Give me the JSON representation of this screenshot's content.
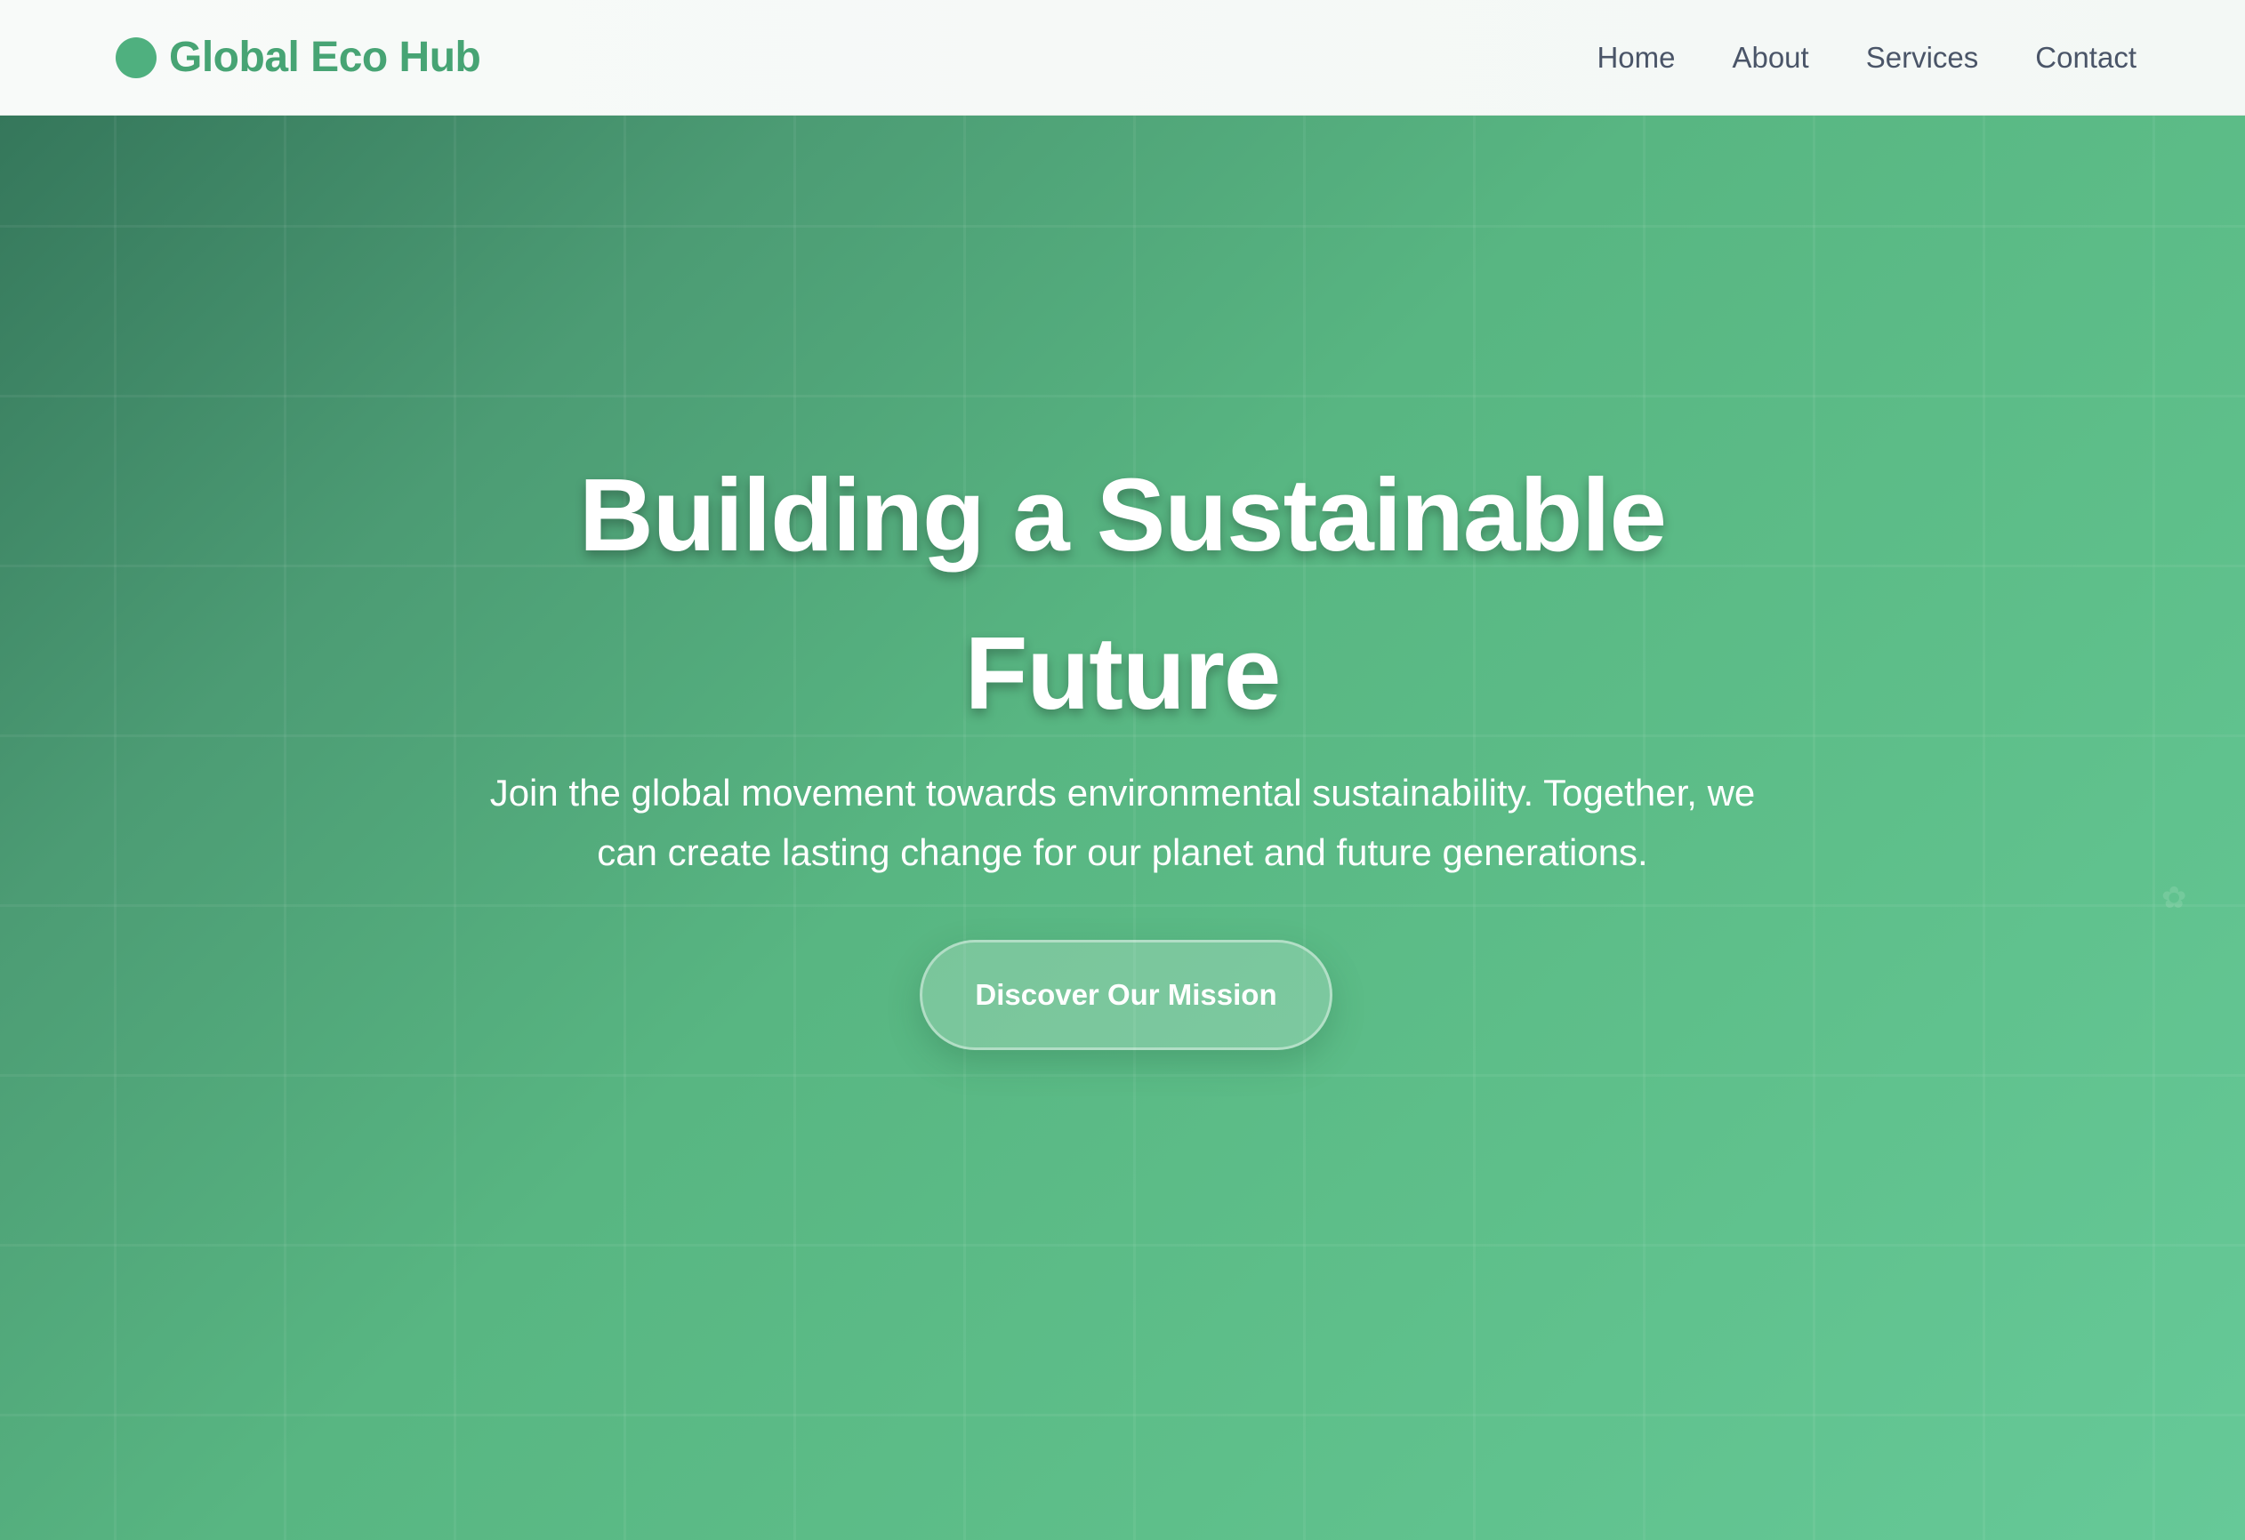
{
  "navbar": {
    "brand": "Global Eco Hub",
    "logo_icon": "eco-globe-icon",
    "links": [
      {
        "label": "Home"
      },
      {
        "label": "About"
      },
      {
        "label": "Services"
      },
      {
        "label": "Contact"
      }
    ]
  },
  "hero": {
    "title": "Building a Sustainable Future",
    "subtitle": "Join the global movement towards environmental sustainability. Together, we can create lasting change for our planet and future generations.",
    "cta_label": "Discover Our Mission"
  },
  "colors": {
    "brand": "#47a474",
    "hero_start": "#35775b",
    "hero_end": "#66c998",
    "nav_text": "#4a5568",
    "hero_text": "#ffffff"
  }
}
